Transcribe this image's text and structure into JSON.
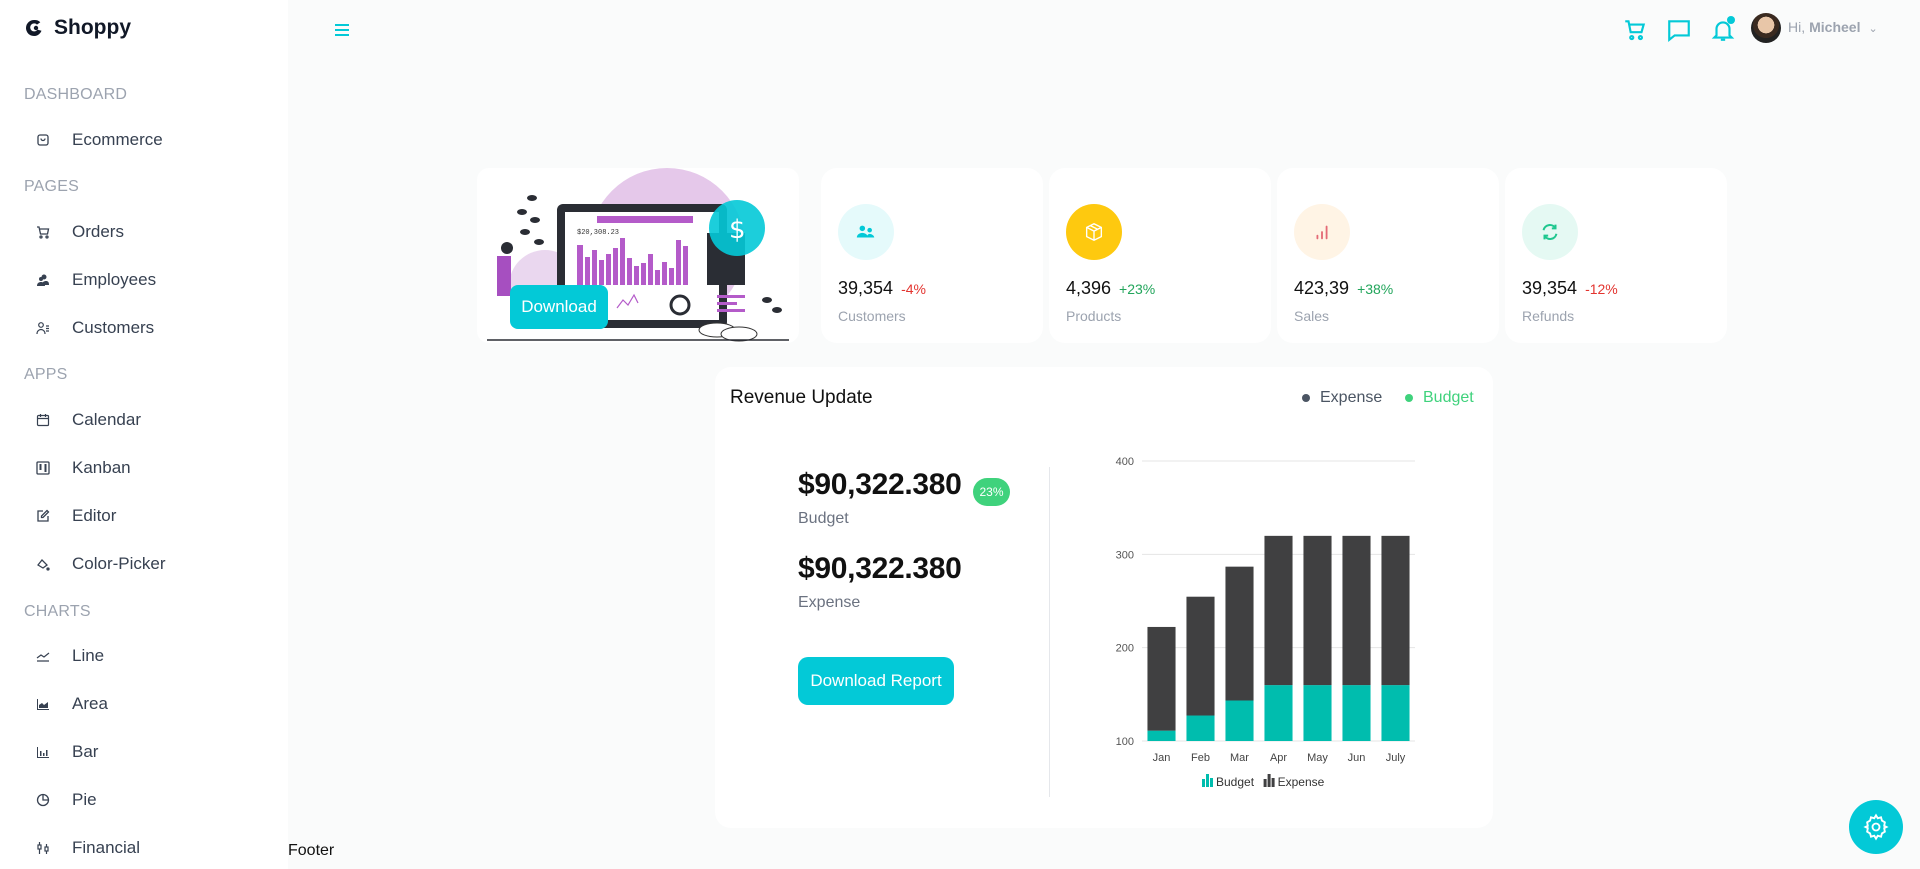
{
  "app": {
    "title": "Shoppy"
  },
  "sidebar": {
    "sections": [
      {
        "title": "DASHBOARD",
        "items": [
          {
            "label": "Ecommerce",
            "icon": "shopping-bag-icon"
          }
        ]
      },
      {
        "title": "PAGES",
        "items": [
          {
            "label": "Orders",
            "icon": "cart-icon"
          },
          {
            "label": "Employees",
            "icon": "employees-icon"
          },
          {
            "label": "Customers",
            "icon": "customers-icon"
          }
        ]
      },
      {
        "title": "APPS",
        "items": [
          {
            "label": "Calendar",
            "icon": "calendar-icon"
          },
          {
            "label": "Kanban",
            "icon": "kanban-icon"
          },
          {
            "label": "Editor",
            "icon": "edit-icon"
          },
          {
            "label": "Color-Picker",
            "icon": "color-picker-icon"
          }
        ]
      },
      {
        "title": "CHARTS",
        "items": [
          {
            "label": "Line",
            "icon": "line-chart-icon"
          },
          {
            "label": "Area",
            "icon": "area-chart-icon"
          },
          {
            "label": "Bar",
            "icon": "bar-chart-icon"
          },
          {
            "label": "Pie",
            "icon": "pie-chart-icon"
          },
          {
            "label": "Financial",
            "icon": "financial-icon"
          }
        ]
      }
    ]
  },
  "topbar": {
    "greeting": "Hi,",
    "user_name": "Micheel",
    "accent_color": "#03c9d7"
  },
  "hero": {
    "download_label": "Download"
  },
  "stats": [
    {
      "value": "39,354",
      "change": "-4%",
      "change_color": "#e3342f",
      "label": "Customers",
      "icon": "customers-icon",
      "icon_color": "#03c9d7",
      "bg": "#e5fafb"
    },
    {
      "value": "4,396",
      "change": "+23%",
      "change_color": "#22a55b",
      "label": "Products",
      "icon": "box-icon",
      "icon_color": "#ffffff",
      "bg": "#fec90f"
    },
    {
      "value": "423,39",
      "change": "+38%",
      "change_color": "#22a55b",
      "label": "Sales",
      "icon": "bar-chart-icon",
      "icon_color": "#e46a76",
      "bg": "#fff4e5"
    },
    {
      "value": "39,354",
      "change": "-12%",
      "change_color": "#e3342f",
      "label": "Refunds",
      "icon": "refresh-icon",
      "icon_color": "#1fc78f",
      "bg": "#e5f9f3"
    }
  ],
  "revenue": {
    "title": "Revenue Update",
    "legend": [
      {
        "label": "Expense",
        "color": "#4b5563"
      },
      {
        "label": "Budget",
        "color": "#3fd27c"
      }
    ],
    "budget_amount": "$90,322.380",
    "budget_badge": "23%",
    "budget_label": "Budget",
    "expense_amount": "$90,322.380",
    "expense_label": "Expense",
    "download_report_label": "Download Report"
  },
  "chart_data": {
    "type": "bar",
    "stacked": true,
    "categories": [
      "Jan",
      "Feb",
      "Mar",
      "Apr",
      "May",
      "Jun",
      "July"
    ],
    "series": [
      {
        "name": "Budget",
        "color": "#00bdae",
        "values": [
          111.1,
          127.3,
          143.4,
          159.9,
          159.9,
          159.9,
          159.9
        ]
      },
      {
        "name": "Expense",
        "color": "#404041",
        "values": [
          111.1,
          127.3,
          143.4,
          159.9,
          159.9,
          159.9,
          159.9
        ]
      }
    ],
    "yticks": [
      100,
      200,
      300,
      400
    ],
    "ylim": [
      100,
      400
    ],
    "grid": true,
    "legend": "bottom",
    "title": "",
    "xlabel": "",
    "ylabel": ""
  },
  "footer": {
    "text": "Footer"
  }
}
